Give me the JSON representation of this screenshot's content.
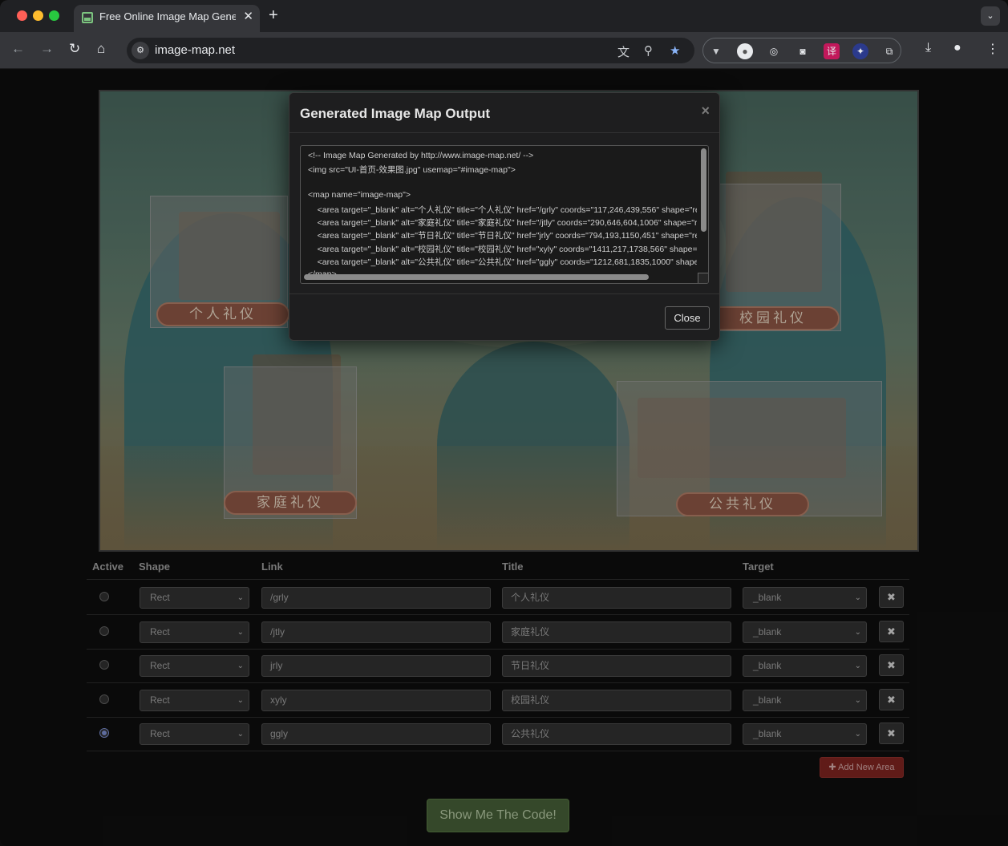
{
  "browser": {
    "tab_title": "Free Online Image Map Generator",
    "tab_close": "✕",
    "new_tab": "+",
    "url": "image-map.net"
  },
  "image_banners": [
    "个人礼仪",
    "家庭礼仪",
    "校园礼仪",
    "公共礼仪"
  ],
  "table": {
    "headers": {
      "active": "Active",
      "shape": "Shape",
      "link": "Link",
      "title": "Title",
      "target": "Target"
    },
    "rows": [
      {
        "shape": "Rect",
        "link": "/grly",
        "title": "个人礼仪",
        "target": "_blank",
        "active": false
      },
      {
        "shape": "Rect",
        "link": "/jtly",
        "title": "家庭礼仪",
        "target": "_blank",
        "active": false
      },
      {
        "shape": "Rect",
        "link": "jrly",
        "title": "节日礼仪",
        "target": "_blank",
        "active": false
      },
      {
        "shape": "Rect",
        "link": "xyly",
        "title": "校园礼仪",
        "target": "_blank",
        "active": false
      },
      {
        "shape": "Rect",
        "link": "ggly",
        "title": "公共礼仪",
        "target": "_blank",
        "active": true
      }
    ],
    "delete_label": "✖"
  },
  "add_area_label": "✚ Add New Area",
  "show_code_label": "Show Me The Code!",
  "modal": {
    "title": "Generated Image Map Output",
    "close_x": "×",
    "code_lines": [
      "<!-- Image Map Generated by http://www.image-map.net/ -->",
      "<img src=\"UI-首页-效果图.jpg\" usemap=\"#image-map\">",
      "",
      "<map name=\"image-map\">",
      "    <area target=\"_blank\" alt=\"个人礼仪\" title=\"个人礼仪\" href=\"/grly\" coords=\"117,246,439,556\" shape=\"rect\">",
      "    <area target=\"_blank\" alt=\"家庭礼仪\" title=\"家庭礼仪\" href=\"/jtly\" coords=\"290,646,604,1006\" shape=\"rect\">",
      "    <area target=\"_blank\" alt=\"节日礼仪\" title=\"节日礼仪\" href=\"jrly\" coords=\"794,193,1150,451\" shape=\"rect\">",
      "    <area target=\"_blank\" alt=\"校园礼仪\" title=\"校园礼仪\" href=\"xyly\" coords=\"1411,217,1738,566\" shape=\"rect\">",
      "    <area target=\"_blank\" alt=\"公共礼仪\" title=\"公共礼仪\" href=\"ggly\" coords=\"1212,681,1835,1000\" shape=\"rect\">",
      "</map>"
    ],
    "close_label": "Close"
  }
}
